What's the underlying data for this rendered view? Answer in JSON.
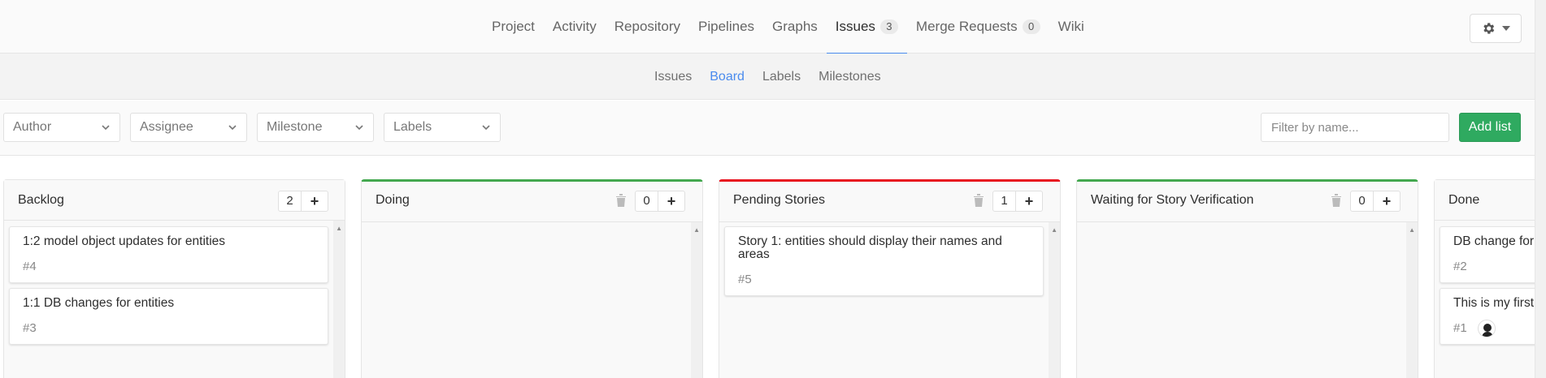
{
  "nav": {
    "items": [
      {
        "label": "Project"
      },
      {
        "label": "Activity"
      },
      {
        "label": "Repository"
      },
      {
        "label": "Pipelines"
      },
      {
        "label": "Graphs"
      },
      {
        "label": "Issues",
        "badge": "3",
        "active": true
      },
      {
        "label": "Merge Requests",
        "badge": "0"
      },
      {
        "label": "Wiki"
      }
    ],
    "settings_icon": "gear-icon"
  },
  "subnav": {
    "items": [
      {
        "label": "Issues"
      },
      {
        "label": "Board",
        "active": true
      },
      {
        "label": "Labels"
      },
      {
        "label": "Milestones"
      }
    ]
  },
  "filters": {
    "author": "Author",
    "assignee": "Assignee",
    "milestone": "Milestone",
    "labels": "Labels",
    "search_placeholder": "Filter by name...",
    "add_list": "Add list"
  },
  "colors": {
    "accent": "#4a8bee",
    "green": "#43a84f",
    "red": "#e8121f",
    "button_green": "#2faa60"
  },
  "lists": [
    {
      "title": "Backlog",
      "count": "2",
      "cards": [
        {
          "title": "1:2 model object updates for entities",
          "number": "#4"
        },
        {
          "title": "1:1 DB changes for entities",
          "number": "#3"
        }
      ]
    },
    {
      "title": "Doing",
      "count": "0",
      "cards": []
    },
    {
      "title": "Pending Stories",
      "count": "1",
      "cards": [
        {
          "title": "Story 1: entities should display their names and areas",
          "number": "#5"
        }
      ]
    },
    {
      "title": "Waiting for Story Verification",
      "count": "0",
      "cards": []
    },
    {
      "title": "Done",
      "cards": [
        {
          "title": "DB change for",
          "number": "#2"
        },
        {
          "title": "This is my first",
          "number": "#1"
        }
      ]
    }
  ]
}
